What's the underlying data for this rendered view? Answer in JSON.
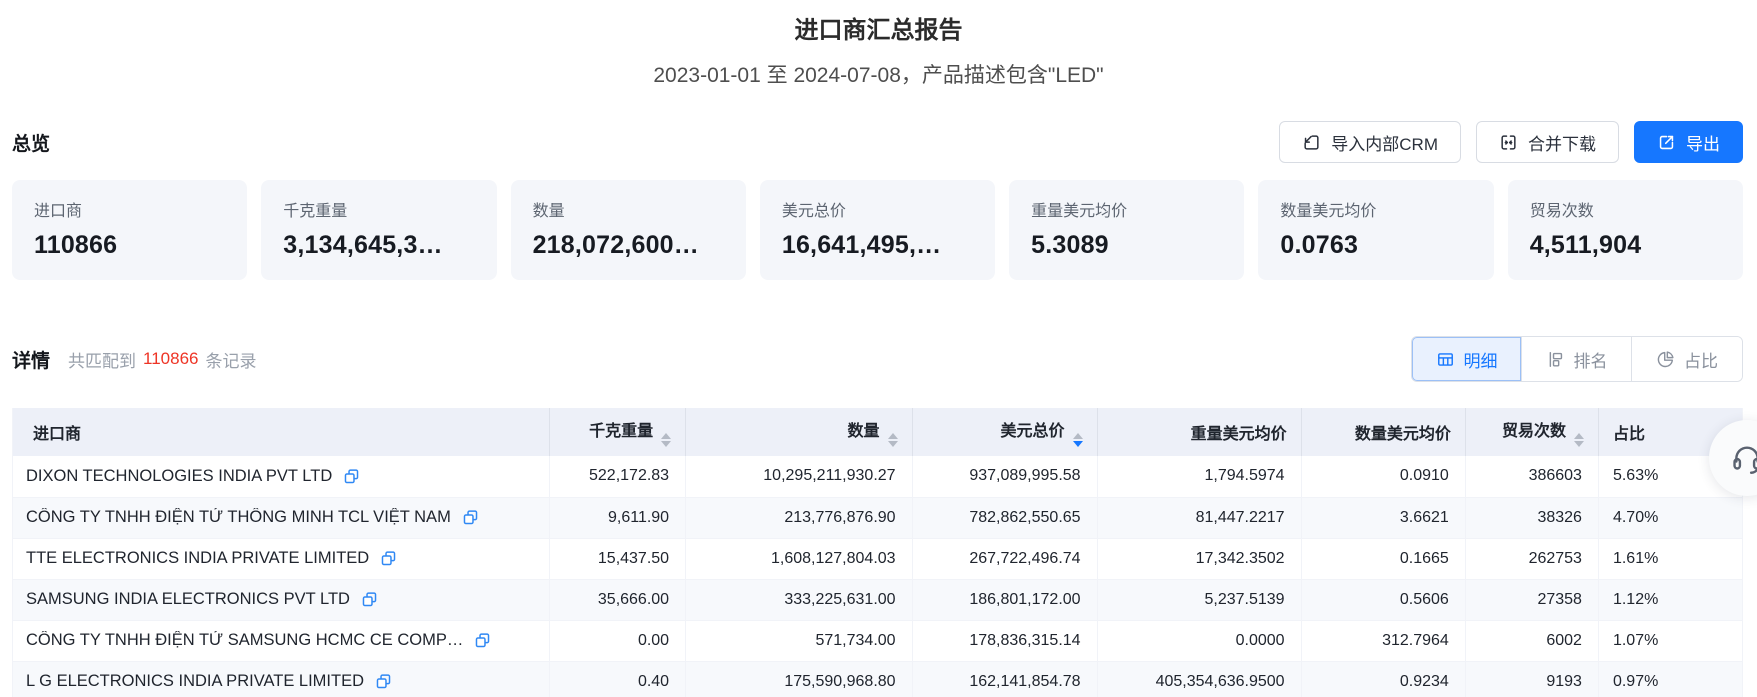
{
  "header": {
    "title": "进口商汇总报告",
    "subtitle": "2023-01-01 至 2024-07-08，产品描述包含\"LED\""
  },
  "overview": {
    "label": "总览",
    "buttons": {
      "import_crm": "导入内部CRM",
      "merge_download": "合并下载",
      "export": "导出"
    },
    "cards": [
      {
        "label": "进口商",
        "value": "110866"
      },
      {
        "label": "千克重量",
        "value": "3,134,645,3…"
      },
      {
        "label": "数量",
        "value": "218,072,600…"
      },
      {
        "label": "美元总价",
        "value": "16,641,495,…"
      },
      {
        "label": "重量美元均价",
        "value": "5.3089"
      },
      {
        "label": "数量美元均价",
        "value": "0.0763"
      },
      {
        "label": "贸易次数",
        "value": "4,511,904"
      }
    ]
  },
  "details": {
    "label": "详情",
    "match_prefix": "共匹配到",
    "match_count": "110866",
    "match_suffix": "条记录",
    "tabs": [
      {
        "label": "明细",
        "icon": "table-grid-icon",
        "active": true
      },
      {
        "label": "排名",
        "icon": "rank-icon",
        "active": false
      },
      {
        "label": "占比",
        "icon": "pie-chart-icon",
        "active": false
      }
    ]
  },
  "table": {
    "columns": [
      {
        "label": "进口商",
        "sortable": false,
        "align": "left"
      },
      {
        "label": "千克重量",
        "sortable": true,
        "align": "right"
      },
      {
        "label": "数量",
        "sortable": true,
        "align": "right"
      },
      {
        "label": "美元总价",
        "sortable": true,
        "sort": "desc",
        "align": "right"
      },
      {
        "label": "重量美元均价",
        "sortable": false,
        "align": "right"
      },
      {
        "label": "数量美元均价",
        "sortable": false,
        "align": "right"
      },
      {
        "label": "贸易次数",
        "sortable": true,
        "align": "right"
      },
      {
        "label": "占比",
        "sortable": false,
        "align": "left"
      }
    ],
    "rows": [
      {
        "importer": "DIXON TECHNOLOGIES INDIA PVT LTD",
        "kg": "522,172.83",
        "qty": "10,295,211,930.27",
        "usd": "937,089,995.58",
        "usd_per_kg": "1,794.5974",
        "usd_per_qty": "0.0910",
        "trades": "386603",
        "share": "5.63%"
      },
      {
        "importer": "CÔNG TY TNHH ĐIỆN TỬ THÔNG MINH TCL VIỆT NAM",
        "kg": "9,611.90",
        "qty": "213,776,876.90",
        "usd": "782,862,550.65",
        "usd_per_kg": "81,447.2217",
        "usd_per_qty": "3.6621",
        "trades": "38326",
        "share": "4.70%"
      },
      {
        "importer": "TTE ELECTRONICS INDIA PRIVATE LIMITED",
        "kg": "15,437.50",
        "qty": "1,608,127,804.03",
        "usd": "267,722,496.74",
        "usd_per_kg": "17,342.3502",
        "usd_per_qty": "0.1665",
        "trades": "262753",
        "share": "1.61%"
      },
      {
        "importer": "SAMSUNG INDIA ELECTRONICS PVT LTD",
        "kg": "35,666.00",
        "qty": "333,225,631.00",
        "usd": "186,801,172.00",
        "usd_per_kg": "5,237.5139",
        "usd_per_qty": "0.5606",
        "trades": "27358",
        "share": "1.12%"
      },
      {
        "importer": "CÔNG TY TNHH ĐIỆN TỬ SAMSUNG HCMC CE COMP…",
        "kg": "0.00",
        "qty": "571,734.00",
        "usd": "178,836,315.14",
        "usd_per_kg": "0.0000",
        "usd_per_qty": "312.7964",
        "trades": "6002",
        "share": "1.07%"
      },
      {
        "importer": "L G ELECTRONICS INDIA PRIVATE LIMITED",
        "kg": "0.40",
        "qty": "175,590,968.80",
        "usd": "162,141,854.78",
        "usd_per_kg": "405,354,636.9500",
        "usd_per_qty": "0.9234",
        "trades": "9193",
        "share": "0.97%"
      }
    ]
  },
  "icons": {
    "import_crm": "import-icon",
    "merge_download": "merge-icon",
    "export": "export-icon",
    "copy": "copy-icon",
    "sort": "sort-carets-icon",
    "support": "headset-icon"
  },
  "colors": {
    "accent_blue": "#1677ff",
    "count_red": "#ee3425",
    "header_bg": "#edf0f8",
    "card_bg": "#f4f6fa"
  }
}
